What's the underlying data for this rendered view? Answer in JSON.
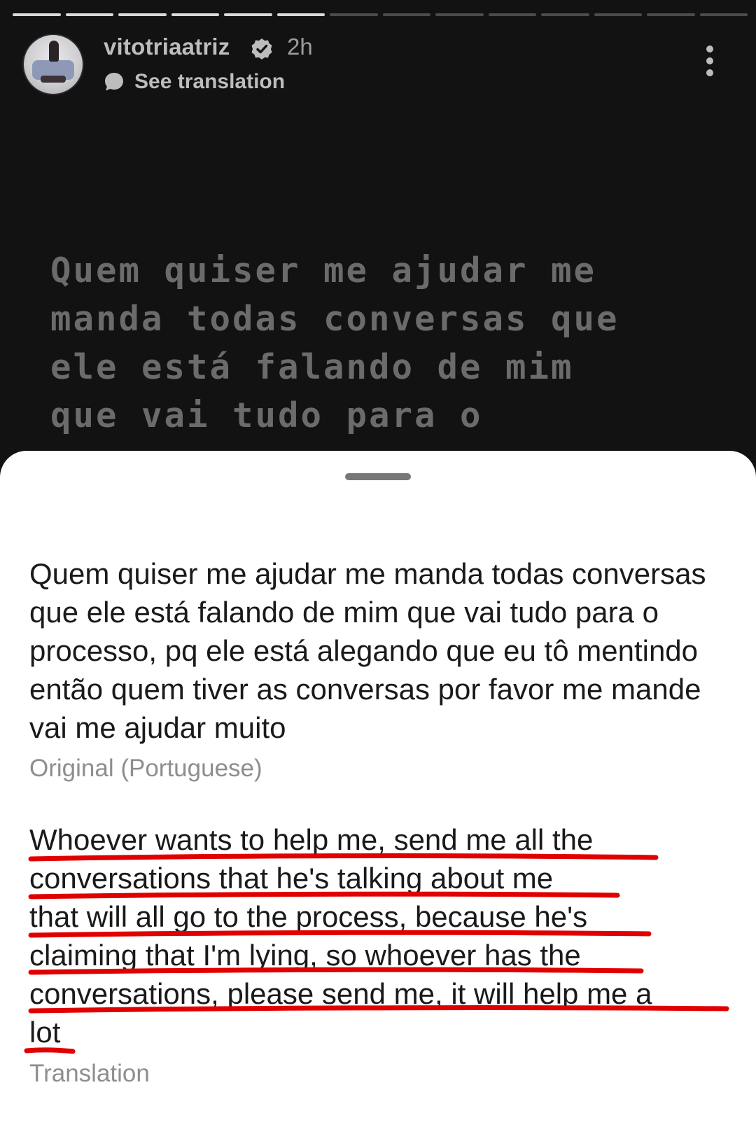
{
  "story": {
    "progress_segments": 14,
    "progress_completed": 6,
    "username": "vitotriaatriz",
    "time": "2h",
    "see_translation": "See translation",
    "text_lines": [
      "Quem quiser me ajudar me",
      "manda todas conversas que",
      "ele está falando de mim",
      "que vai tudo para o"
    ]
  },
  "sheet": {
    "original_text": "Quem quiser me ajudar me manda todas conversas que ele está falando de mim que vai tudo para o processo, pq ele está alegando que eu tô mentindo então quem tiver as conversas por favor me mande vai me ajudar muito",
    "original_label": "Original (Portuguese)",
    "translation_lines": [
      "Whoever wants to help me, send me all the",
      "conversations that he's talking about me",
      "that will all go to the process, because he's",
      "claiming that I'm lying, so whoever has the",
      "conversations, please send me, it will help me a",
      "lot"
    ],
    "translation_label": "Translation"
  },
  "colors": {
    "story_background": "#121212",
    "sheet_background": "#ffffff",
    "annotation_red": "#e00000",
    "muted_label": "#8e8e8e"
  },
  "icons": [
    "verified-badge-icon",
    "translate-bubble-icon",
    "more-options-icon"
  ]
}
